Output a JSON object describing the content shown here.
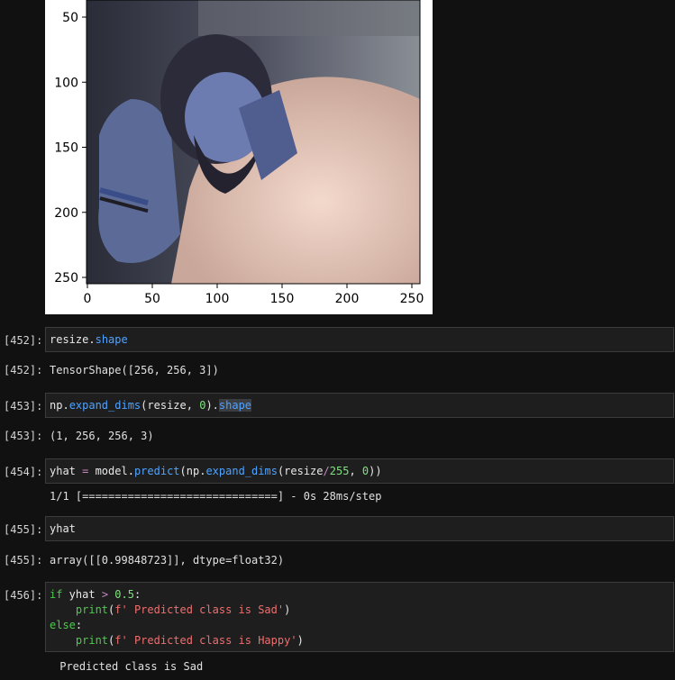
{
  "plot": {
    "y_ticks": [
      "50",
      "100",
      "150",
      "200",
      "250"
    ],
    "x_ticks": [
      "0",
      "50",
      "100",
      "150",
      "200",
      "250"
    ],
    "image_desc": "photo-sad-man"
  },
  "cells": [
    {
      "prompt_in": "[452]:",
      "code_tokens": [
        {
          "t": "resize",
          "c": "plain"
        },
        {
          "t": ".",
          "c": "plain"
        },
        {
          "t": "shape",
          "c": "fn"
        }
      ],
      "prompt_out": "[452]:",
      "output": "TensorShape([256, 256, 3])"
    },
    {
      "prompt_in": "[453]:",
      "code_tokens": [
        {
          "t": "np",
          "c": "plain"
        },
        {
          "t": ".",
          "c": "plain"
        },
        {
          "t": "expand_dims",
          "c": "fn"
        },
        {
          "t": "(resize, ",
          "c": "plain"
        },
        {
          "t": "0",
          "c": "num"
        },
        {
          "t": ").",
          "c": "plain"
        },
        {
          "t": "shape",
          "c": "fn-sel"
        }
      ],
      "prompt_out": "[453]:",
      "output": "(1, 256, 256, 3)"
    },
    {
      "prompt_in": "[454]:",
      "code_tokens": [
        {
          "t": "yhat ",
          "c": "plain"
        },
        {
          "t": "=",
          "c": "op"
        },
        {
          "t": " model",
          "c": "plain"
        },
        {
          "t": ".",
          "c": "plain"
        },
        {
          "t": "predict",
          "c": "fn"
        },
        {
          "t": "(np",
          "c": "plain"
        },
        {
          "t": ".",
          "c": "plain"
        },
        {
          "t": "expand_dims",
          "c": "fn"
        },
        {
          "t": "(resize",
          "c": "plain"
        },
        {
          "t": "/",
          "c": "op"
        },
        {
          "t": "255",
          "c": "num"
        },
        {
          "t": ", ",
          "c": "plain"
        },
        {
          "t": "0",
          "c": "num"
        },
        {
          "t": "))",
          "c": "plain"
        }
      ],
      "output": "1/1 [==============================] - 0s 28ms/step"
    },
    {
      "prompt_in": "[455]:",
      "code_tokens": [
        {
          "t": "yhat",
          "c": "plain"
        }
      ],
      "prompt_out": "[455]:",
      "output": "array([[0.99848723]], dtype=float32)"
    },
    {
      "prompt_in": "[456]:",
      "code_lines": [
        [
          {
            "t": "if",
            "c": "kw"
          },
          {
            "t": " yhat ",
            "c": "plain"
          },
          {
            "t": ">",
            "c": "op"
          },
          {
            "t": " ",
            "c": "plain"
          },
          {
            "t": "0.5",
            "c": "num"
          },
          {
            "t": ":",
            "c": "plain"
          }
        ],
        [
          {
            "t": "    ",
            "c": "plain"
          },
          {
            "t": "print",
            "c": "kw"
          },
          {
            "t": "(",
            "c": "plain"
          },
          {
            "t": "f' Predicted class is Sad'",
            "c": "str"
          },
          {
            "t": ")",
            "c": "plain"
          }
        ],
        [
          {
            "t": "else",
            "c": "kw"
          },
          {
            "t": ":",
            "c": "plain"
          }
        ],
        [
          {
            "t": "    ",
            "c": "plain"
          },
          {
            "t": "print",
            "c": "kw"
          },
          {
            "t": "(",
            "c": "plain"
          },
          {
            "t": "f' Predicted class is Happy'",
            "c": "str"
          },
          {
            "t": ")",
            "c": "plain"
          }
        ]
      ],
      "output": " Predicted class is Sad"
    }
  ]
}
